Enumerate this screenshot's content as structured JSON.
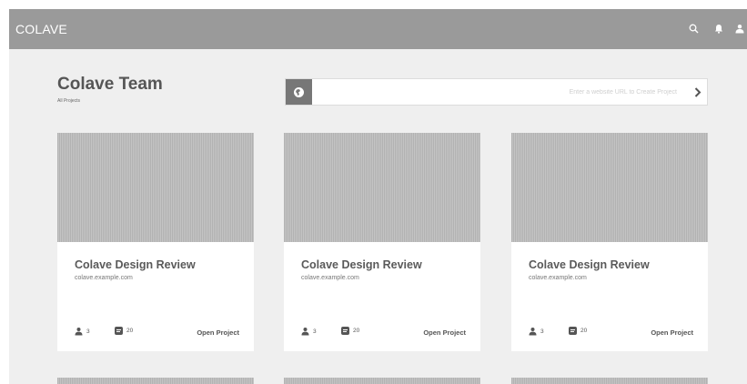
{
  "app": {
    "brand": "COLAVE"
  },
  "header_icons": [
    "search-icon",
    "bell-icon",
    "user-icon"
  ],
  "team": {
    "title": "Colave Team",
    "subtitle": "All Projects"
  },
  "url_bar": {
    "placeholder": "Enter a website URL to Create Project",
    "value": ""
  },
  "projects": [
    {
      "title": "Colave Design Review",
      "url": "colave.example.com",
      "members": "3",
      "comments": "20",
      "action": "Open Project"
    },
    {
      "title": "Colave Design Review",
      "url": "colave.example.com",
      "members": "3",
      "comments": "20",
      "action": "Open Project"
    },
    {
      "title": "Colave Design Review",
      "url": "colave.example.com",
      "members": "3",
      "comments": "20",
      "action": "Open Project"
    }
  ],
  "colors": {
    "topbar": "#9a9a9a",
    "page_bg": "#efefef",
    "card_bg": "#ffffff",
    "thumb": "#bcbcbc",
    "text": "#555555"
  }
}
